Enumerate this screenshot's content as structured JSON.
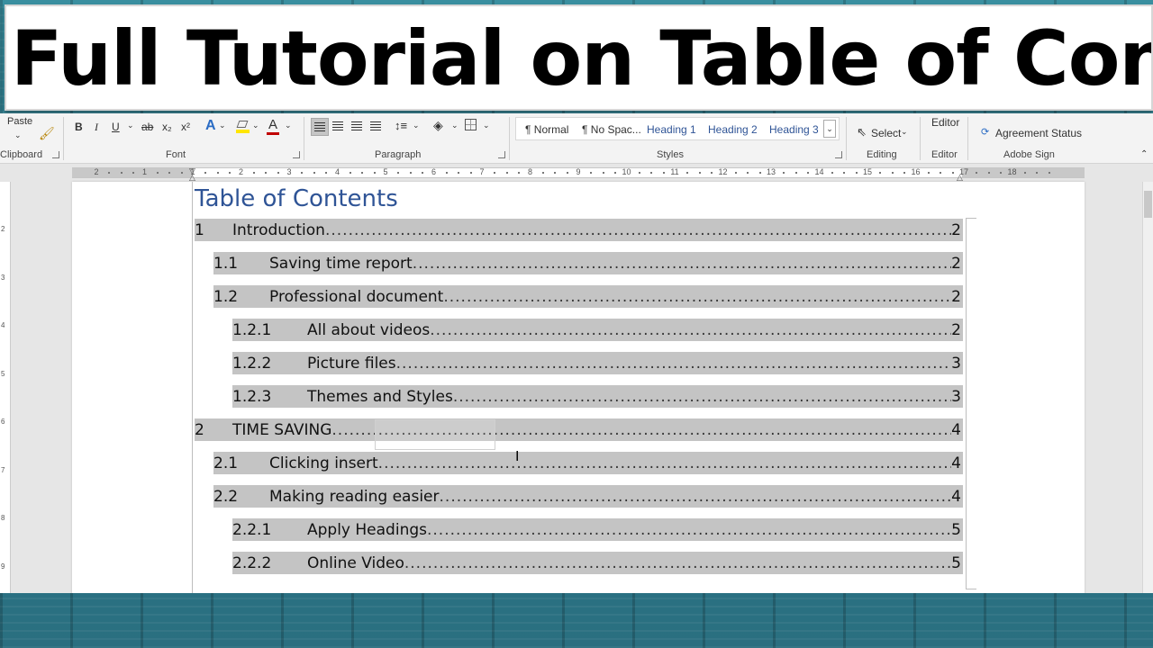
{
  "banner": {
    "title": "Full Tutorial on Table of Content"
  },
  "ribbon": {
    "clipboard": {
      "paste_label": "Paste",
      "group_label": "Clipboard"
    },
    "font": {
      "group_label": "Font",
      "bold": "B",
      "italic": "I",
      "underline": "U",
      "strikethrough": "ab",
      "subscript": "x₂",
      "superscript": "x²",
      "text_effects": "A",
      "font_color": "A"
    },
    "paragraph": {
      "group_label": "Paragraph"
    },
    "styles": {
      "group_label": "Styles",
      "items": [
        "¶ Normal",
        "¶ No Spac...",
        "Heading 1",
        "Heading 2",
        "Heading 3"
      ]
    },
    "editing": {
      "group_label": "Editing",
      "select_label": "Select"
    },
    "editor": {
      "button_label": "Editor",
      "group_label": "Editor"
    },
    "adobe": {
      "button_label": "Agreement Status",
      "group_label": "Adobe Sign"
    }
  },
  "ruler": {
    "numbers": [
      "2",
      "1",
      "1",
      "2",
      "3",
      "4",
      "5",
      "6",
      "7",
      "8",
      "9",
      "10",
      "11",
      "12",
      "13",
      "14",
      "15",
      "16",
      "17",
      "18"
    ],
    "vertical_numbers": [
      "2",
      "3",
      "4",
      "5",
      "6",
      "7",
      "8",
      "9",
      "10"
    ]
  },
  "document": {
    "toc_title": "Table of Contents",
    "entries": [
      {
        "num": "1",
        "text": "Introduction",
        "page": "2",
        "level": 1
      },
      {
        "num": "1.1",
        "text": "Saving time report",
        "page": "2",
        "level": 2
      },
      {
        "num": "1.2",
        "text": "Professional document",
        "page": "2",
        "level": 2
      },
      {
        "num": "1.2.1",
        "text": "All about videos",
        "page": "2",
        "level": 3
      },
      {
        "num": "1.2.2",
        "text": "Picture files",
        "page": "3",
        "level": 3
      },
      {
        "num": "1.2.3",
        "text": "Themes and Styles",
        "page": "3",
        "level": 3
      },
      {
        "num": "2",
        "text": "TIME SAVING",
        "page": "4",
        "level": 1
      },
      {
        "num": "2.1",
        "text": "Clicking insert",
        "page": "4",
        "level": 2
      },
      {
        "num": "2.2",
        "text": "Making reading easier",
        "page": "4",
        "level": 2
      },
      {
        "num": "2.2.1",
        "text": "Apply Headings",
        "page": "5",
        "level": 3
      },
      {
        "num": "2.2.2",
        "text": "Online Video",
        "page": "5",
        "level": 3
      }
    ]
  },
  "colors": {
    "heading_blue": "#2f5496",
    "toc_highlight": "#c4c4c4",
    "background_teal": "#2f7e8f"
  }
}
